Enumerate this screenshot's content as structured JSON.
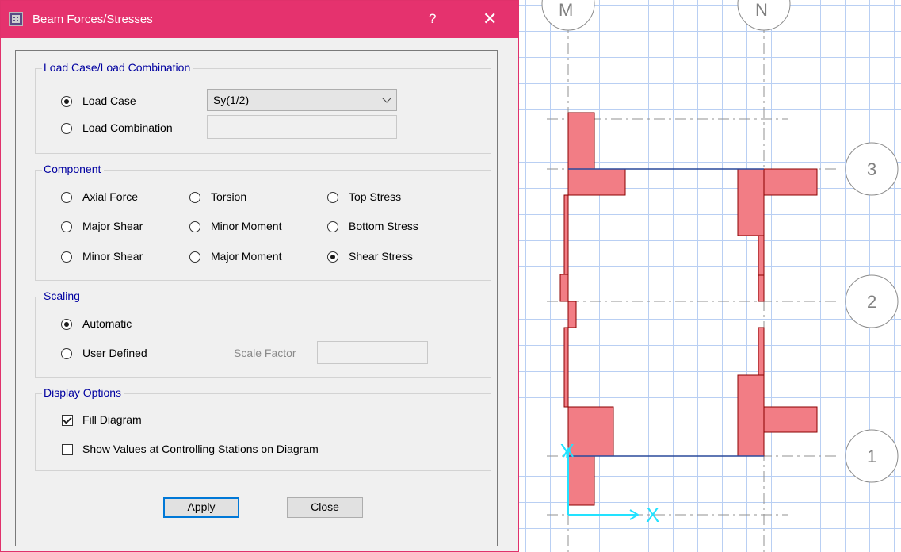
{
  "window": {
    "title": "Beam Forces/Stresses",
    "help_label": "?",
    "close_label": "✕"
  },
  "load_case_group": {
    "title": "Load Case/Load Combination",
    "options": [
      {
        "label": "Load Case",
        "selected": true
      },
      {
        "label": "Load Combination",
        "selected": false
      }
    ],
    "load_case_value": "Sy(1/2)",
    "load_combination_value": ""
  },
  "component_group": {
    "title": "Component",
    "options": [
      {
        "label": "Axial Force",
        "selected": false
      },
      {
        "label": "Torsion",
        "selected": false
      },
      {
        "label": "Top Stress",
        "selected": false
      },
      {
        "label": "Major Shear",
        "selected": false
      },
      {
        "label": "Minor Moment",
        "selected": false
      },
      {
        "label": "Bottom Stress",
        "selected": false
      },
      {
        "label": "Minor Shear",
        "selected": false
      },
      {
        "label": "Major Moment",
        "selected": false
      },
      {
        "label": "Shear Stress",
        "selected": true
      }
    ]
  },
  "scaling_group": {
    "title": "Scaling",
    "options": [
      {
        "label": "Automatic",
        "selected": true
      },
      {
        "label": "User Defined",
        "selected": false
      }
    ],
    "scale_factor_label": "Scale Factor",
    "scale_factor_value": ""
  },
  "display_group": {
    "title": "Display Options",
    "options": [
      {
        "label": "Fill Diagram",
        "checked": true
      },
      {
        "label": "Show Values at Controlling Stations on Diagram",
        "checked": false
      }
    ]
  },
  "buttons": {
    "apply": "Apply",
    "close": "Close"
  },
  "canvas": {
    "grid_bubbles": [
      "M",
      "N",
      "3",
      "2",
      "1"
    ],
    "axis_labels": {
      "x": "X",
      "y": "Y"
    },
    "colors": {
      "grid": "#b9cff3",
      "diagram_fill": "#f27d85",
      "diagram_stroke": "#8b0000",
      "axis": "#22e2ff",
      "titlebar": "#e5326e"
    }
  }
}
